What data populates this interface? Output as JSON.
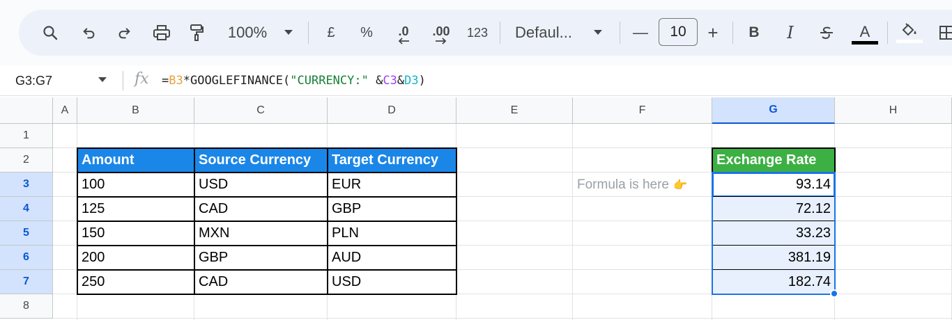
{
  "toolbar": {
    "zoom": "100%",
    "currency_label": "£",
    "percent_label": "%",
    "decrease_decimal_label": ".0",
    "increase_decimal_label": ".00",
    "number_format_label": "123",
    "font_name": "Defaul...",
    "font_size": "10",
    "minus_label": "—",
    "plus_label": "+",
    "bold_label": "B",
    "italic_label": "I",
    "text_color_label": "A"
  },
  "formula_bar": {
    "name_box": "G3:G7",
    "fx_label": "fx",
    "formula_parts": [
      {
        "text": "=",
        "color": "#1f1f1f"
      },
      {
        "text": "B3",
        "color": "#e8a23b"
      },
      {
        "text": "*GOOGLEFINANCE(",
        "color": "#1f1f1f"
      },
      {
        "text": "\"CURRENCY:\"",
        "color": "#188038"
      },
      {
        "text": " &",
        "color": "#1f1f1f"
      },
      {
        "text": "C3",
        "color": "#a142f4"
      },
      {
        "text": "&",
        "color": "#1f1f1f"
      },
      {
        "text": "D3",
        "color": "#12b5cb"
      },
      {
        "text": ")",
        "color": "#1f1f1f"
      }
    ]
  },
  "columns": [
    "A",
    "B",
    "C",
    "D",
    "E",
    "F",
    "G",
    "H"
  ],
  "rows": [
    "1",
    "2",
    "3",
    "4",
    "5",
    "6",
    "7",
    "8"
  ],
  "table": {
    "headers": [
      "Amount",
      "Source Currency",
      "Target Currency"
    ],
    "rows": [
      [
        "100",
        "USD",
        "EUR"
      ],
      [
        "125",
        "CAD",
        "GBP"
      ],
      [
        "150",
        "MXN",
        "PLN"
      ],
      [
        "200",
        "GBP",
        "AUD"
      ],
      [
        "250",
        "CAD",
        "USD"
      ]
    ]
  },
  "exchange": {
    "header": "Exchange Rate",
    "values": [
      "93.14",
      "72.12",
      "33.23",
      "381.19",
      "182.74"
    ]
  },
  "note": {
    "text": "Formula is here",
    "emoji": "👉"
  },
  "colors": {
    "header_blue": "#1a86e8",
    "header_green": "#3cb043",
    "selection": "#1a73e8"
  }
}
